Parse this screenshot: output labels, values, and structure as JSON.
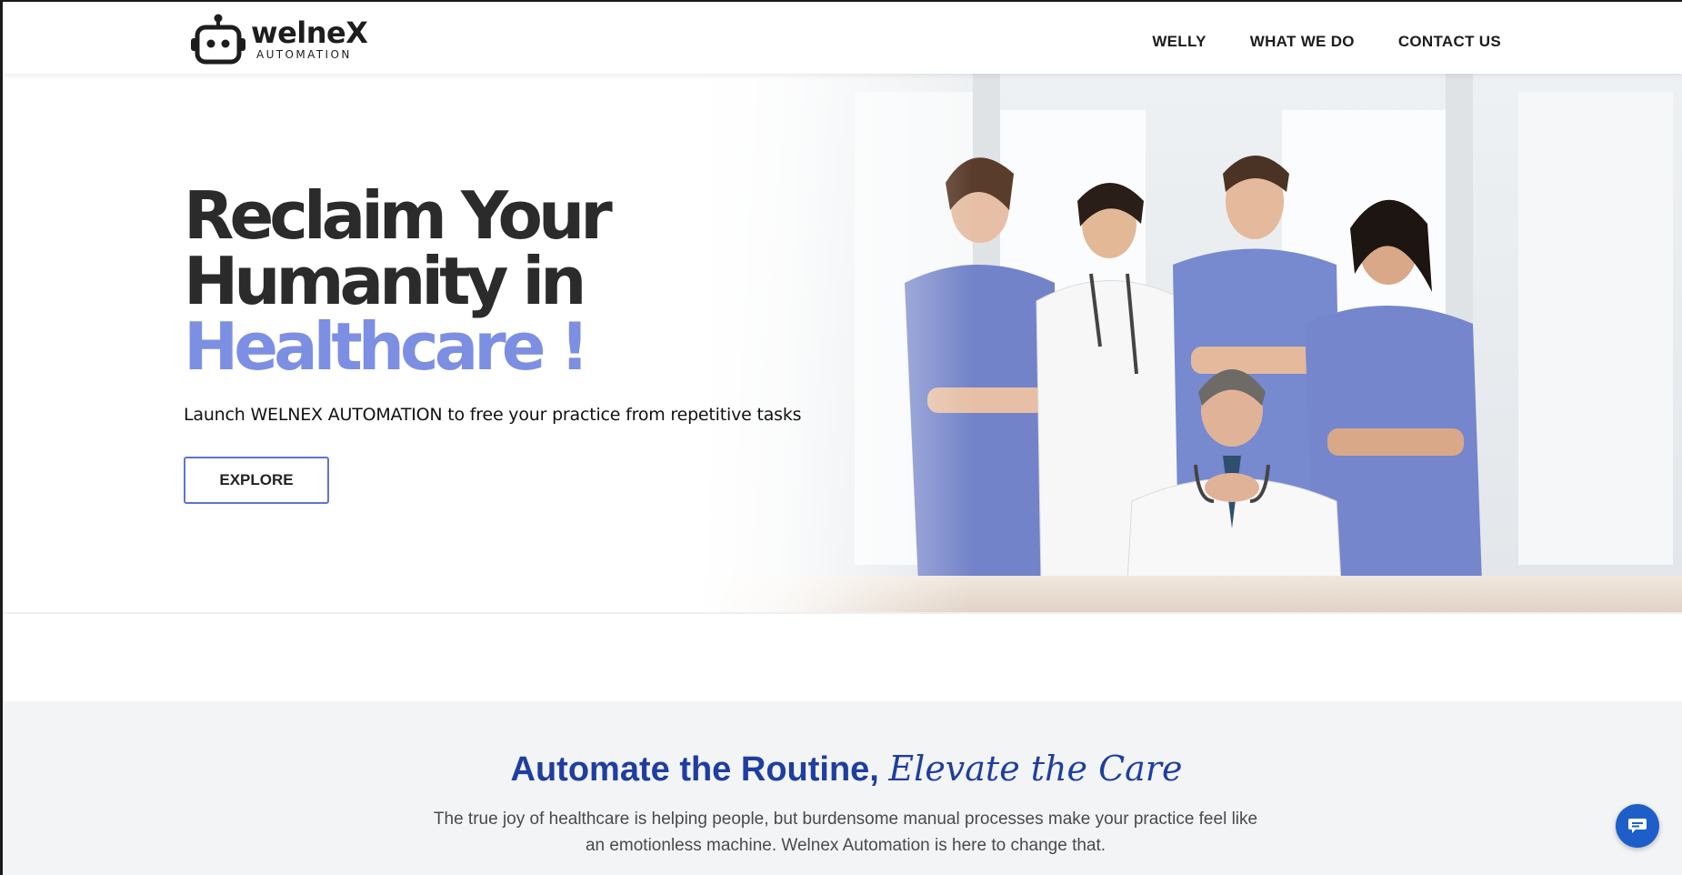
{
  "brand": {
    "name": "welneX",
    "tagline": "AUTOMATION"
  },
  "nav": {
    "items": [
      {
        "label": "WELLY"
      },
      {
        "label": "WHAT WE DO"
      },
      {
        "label": "CONTACT US"
      }
    ]
  },
  "hero": {
    "title_line1": "Reclaim Your",
    "title_line2": "Humanity in",
    "title_accent": "Healthcare !",
    "subtitle": "Launch WELNEX AUTOMATION to free your practice from repetitive tasks",
    "cta_label": "EXPLORE",
    "image": "healthcare-team-photo"
  },
  "intro": {
    "title_bold": "Automate the Routine,",
    "title_italic": "Elevate the Care",
    "text": "The true joy of healthcare is helping people, but burdensome manual processes make your practice feel like an emotionless machine. Welnex Automation is here to change that."
  },
  "chat": {
    "icon": "chat-icon"
  },
  "colors": {
    "accent": "#7d8fe2",
    "primary_blue": "#1f3ea0",
    "button_border": "#5b74d6",
    "chat_button": "#1e5ec9",
    "section_bg": "#f3f4f6"
  }
}
